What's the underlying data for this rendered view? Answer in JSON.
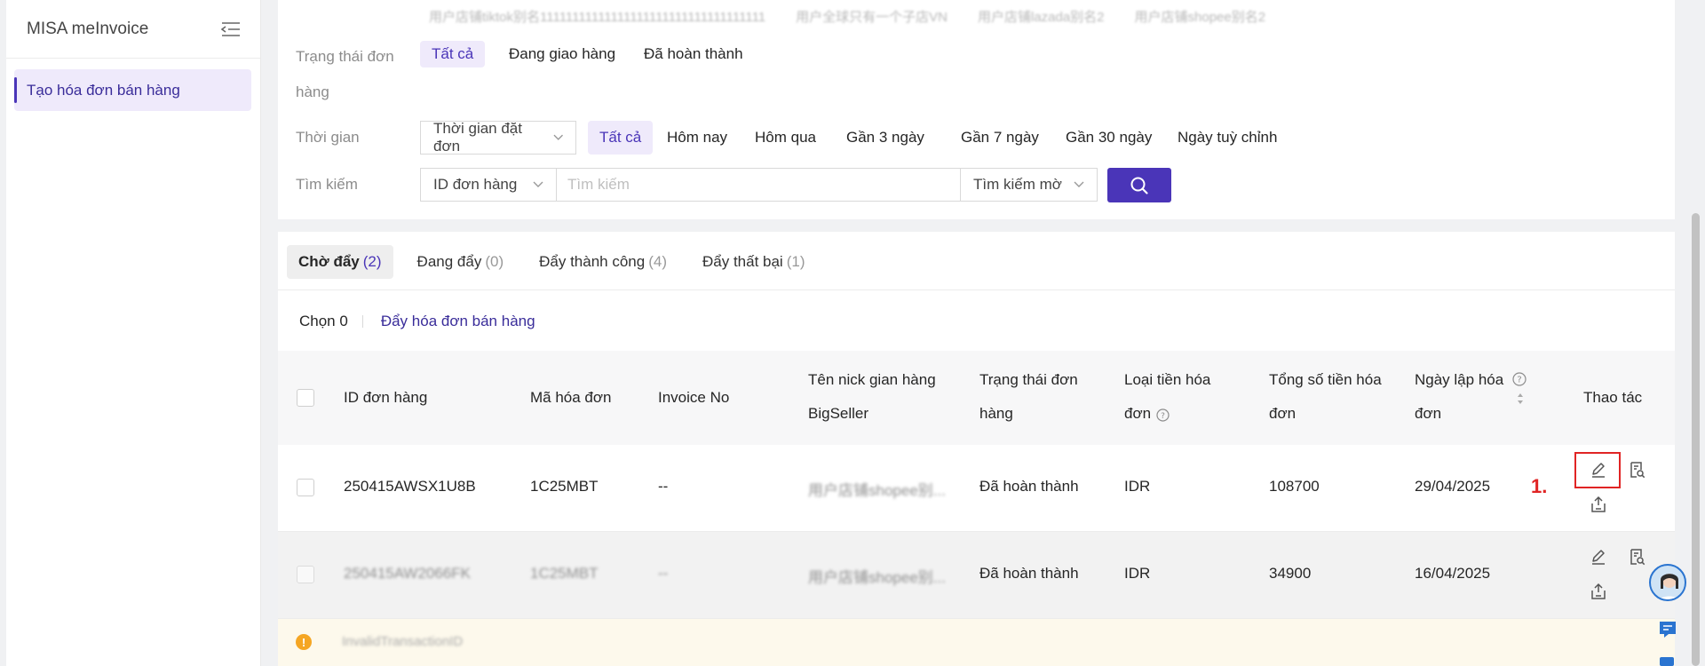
{
  "sidebar": {
    "brand": "MISA meInvoice",
    "menu": [
      {
        "label": "Tạo hóa đơn bán hàng",
        "active": true
      }
    ]
  },
  "filters": {
    "stores": [
      "用户店铺tiktok别名11111111111111111111111111111111111",
      "用户全球只有一个子店VN",
      "用户店铺lazada别名2",
      "用户店铺shopee别名2"
    ],
    "status": {
      "label_line1": "Trạng thái đơn",
      "label_line2": "hàng",
      "options": [
        "Tất cả",
        "Đang giao hàng",
        "Đã hoàn thành"
      ],
      "selected": "Tất cả"
    },
    "time": {
      "label": "Thời gian",
      "select_value": "Thời gian đặt đơn",
      "options": [
        "Tất cả",
        "Hôm nay",
        "Hôm qua",
        "Gần 3 ngày",
        "Gần 7 ngày",
        "Gần 30 ngày",
        "Ngày tuỳ chỉnh"
      ],
      "selected": "Tất cả"
    },
    "search": {
      "label": "Tìm kiếm",
      "field_value": "ID đơn hàng",
      "placeholder": "Tìm kiếm",
      "mode_value": "Tìm kiếm mờ"
    }
  },
  "tabs": [
    {
      "label": "Chờ đẩy",
      "count": "(2)",
      "active": true
    },
    {
      "label": "Đang đẩy",
      "count": "(0)"
    },
    {
      "label": "Đẩy thành công",
      "count": "(4)"
    },
    {
      "label": "Đẩy thất bại",
      "count": "(1)"
    }
  ],
  "bulk": {
    "selected_label": "Chọn 0",
    "action_label": "Đẩy hóa đơn bán hàng"
  },
  "table": {
    "headers": {
      "order_id": "ID đơn hàng",
      "invoice_code": "Mã hóa đơn",
      "invoice_no": "Invoice No",
      "store_nick_1": "Tên nick gian hàng",
      "store_nick_2": "BigSeller",
      "order_status_1": "Trạng thái đơn",
      "order_status_2": "hàng",
      "currency_1": "Loại tiền hóa",
      "currency_2": "đơn",
      "total_1": "Tổng số tiền hóa",
      "total_2": "đơn",
      "date_1": "Ngày lập hóa",
      "date_2": "đơn",
      "actions": "Thao tác"
    },
    "rows": [
      {
        "order_id": "250415AWSX1U8B",
        "invoice_code": "1C25MBT",
        "invoice_no": "--",
        "store": "用户店铺shopee别...",
        "status": "Đã hoàn thành",
        "currency": "IDR",
        "total": "108700",
        "date": "29/04/2025"
      },
      {
        "order_id": "250415AW2066FK",
        "invoice_code": "1C25MBT",
        "invoice_no": "--",
        "store": "用户店铺shopee别...",
        "status": "Đã hoàn thành",
        "currency": "IDR",
        "total": "34900",
        "date": "16/04/2025"
      }
    ],
    "warning": "InvalidTransactionID"
  },
  "annotation": {
    "step": "1."
  },
  "colors": {
    "primary": "#4a35b8",
    "highlight": "#e02424",
    "warning": "#f5a623"
  }
}
